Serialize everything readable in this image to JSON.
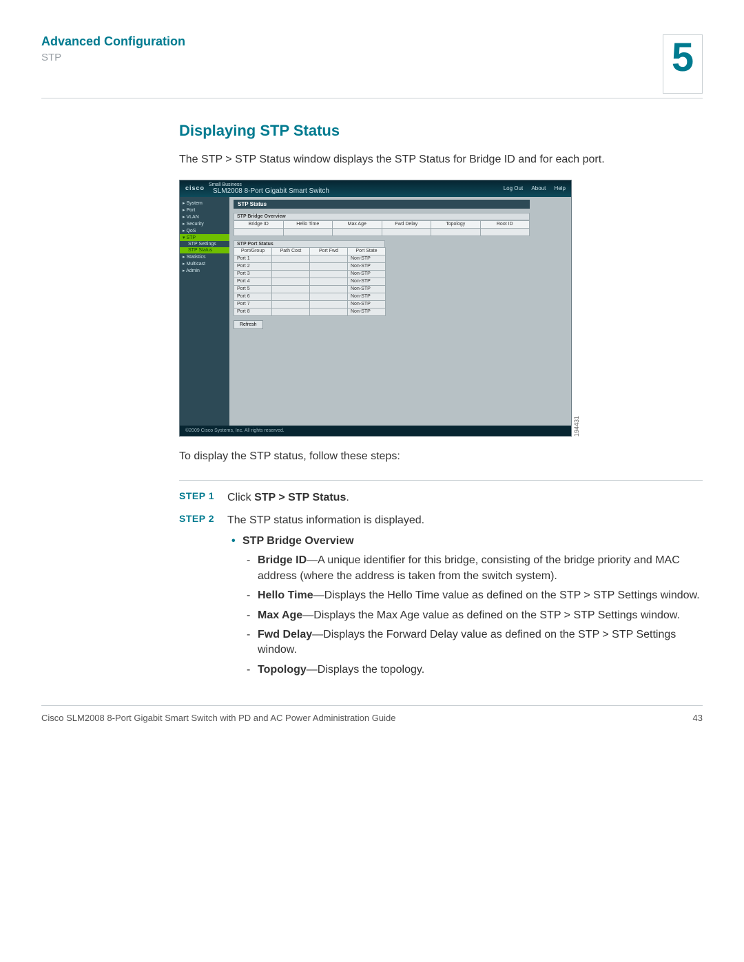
{
  "header": {
    "section": "Advanced Configuration",
    "subsection": "STP",
    "chapter": "5"
  },
  "section_title": "Displaying STP Status",
  "intro": "The STP > STP Status window displays the STP Status for Bridge ID and for each port.",
  "lead_out": "To display the STP status, follow these steps:",
  "screenshot": {
    "sidecode": "194431",
    "top": {
      "brand_small": "Small Business",
      "brand": "cisco",
      "title": "SLM2008 8-Port Gigabit Smart Switch",
      "links": [
        "Log Out",
        "About",
        "Help"
      ]
    },
    "nav": [
      "▸ System",
      "▸ Port",
      "▸ VLAN",
      "▸ Security",
      "▸ QoS"
    ],
    "nav_active": "▾ STP",
    "nav_sub": [
      "STP Settings"
    ],
    "nav_sub_hl": "STP Status",
    "nav_after": [
      "▸ Statistics",
      "▸ Multicast",
      "▸ Admin"
    ],
    "pane_title": "STP Status",
    "bridge_hdr": "STP Bridge Overview",
    "bridge_cols": [
      "Bridge ID",
      "Hello Time",
      "Max Age",
      "Fwd Delay",
      "Topology",
      "Root ID"
    ],
    "port_hdr": "STP Port Status",
    "port_cols": [
      "Port/Group",
      "Path Cost",
      "Port Fwd",
      "Port State"
    ],
    "ports": [
      {
        "p": "Port 1",
        "s": "Non-STP"
      },
      {
        "p": "Port 2",
        "s": "Non-STP"
      },
      {
        "p": "Port 3",
        "s": "Non-STP"
      },
      {
        "p": "Port 4",
        "s": "Non-STP"
      },
      {
        "p": "Port 5",
        "s": "Non-STP"
      },
      {
        "p": "Port 6",
        "s": "Non-STP"
      },
      {
        "p": "Port 7",
        "s": "Non-STP"
      },
      {
        "p": "Port 8",
        "s": "Non-STP"
      }
    ],
    "refresh": "Refresh",
    "copyright": "©2009 Cisco Systems, Inc. All rights reserved."
  },
  "steps": {
    "label": "STEP",
    "s1_pre": "Click ",
    "s1_bold": "STP > STP Status",
    "s1_post": ".",
    "s2": "The STP status information is displayed.",
    "bullet1": "STP Bridge Overview",
    "items": [
      {
        "b": "Bridge ID",
        "t": "—A unique identifier for this bridge, consisting of the bridge priority and MAC address (where the address is taken from the switch system)."
      },
      {
        "b": "Hello Time",
        "t": "—Displays the Hello Time value as defined on the STP > STP Settings window."
      },
      {
        "b": "Max Age",
        "t": "—Displays the Max Age value as defined on the STP > STP Settings window."
      },
      {
        "b": "Fwd Delay",
        "t": "—Displays the Forward Delay value as defined on the STP > STP Settings window."
      },
      {
        "b": "Topology",
        "t": "—Displays the topology."
      }
    ]
  },
  "footer": {
    "left": "Cisco SLM2008 8-Port Gigabit Smart Switch with PD and AC Power Administration Guide",
    "right": "43"
  }
}
